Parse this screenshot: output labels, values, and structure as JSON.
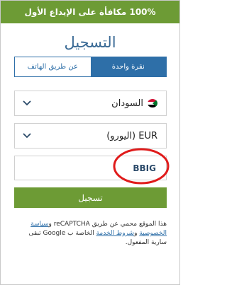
{
  "banner": {
    "text": "100% مكافأة على الإيداع الأول"
  },
  "title": "التسجيل",
  "tabs": [
    {
      "label": "نقرة واحدة",
      "active": true
    },
    {
      "label": "عن طريق الهاتف",
      "active": false
    }
  ],
  "country": {
    "value": "السودان",
    "icon": "sudan-flag-icon"
  },
  "currency": {
    "value": "EUR (اليورو)"
  },
  "promo": {
    "value": "BBIG"
  },
  "submit": {
    "label": "تسجيل"
  },
  "legal": {
    "part1": "هذا الموقع محمي عن طريق reCAPTCHA و",
    "privacy": "سياسة الخصوصية",
    "part2": " و",
    "terms": "شروط الخدمة",
    "part3": " الخاصة ب Google تبقى سارية المفعول."
  },
  "colors": {
    "green": "#6d9b35",
    "blue": "#2e6fa8",
    "annotation_red": "#e01b1b"
  }
}
